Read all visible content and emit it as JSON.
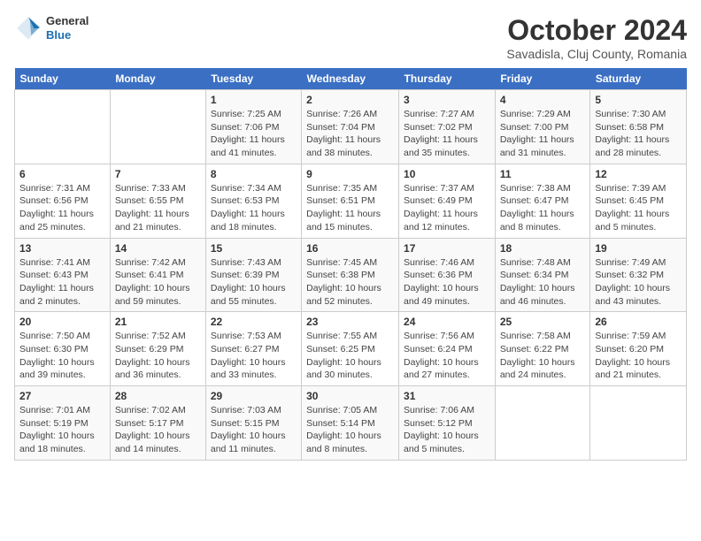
{
  "header": {
    "logo_line1": "General",
    "logo_line2": "Blue",
    "month": "October 2024",
    "location": "Savadisla, Cluj County, Romania"
  },
  "weekdays": [
    "Sunday",
    "Monday",
    "Tuesday",
    "Wednesday",
    "Thursday",
    "Friday",
    "Saturday"
  ],
  "weeks": [
    [
      {
        "day": "",
        "sunrise": "",
        "sunset": "",
        "daylight": ""
      },
      {
        "day": "",
        "sunrise": "",
        "sunset": "",
        "daylight": ""
      },
      {
        "day": "1",
        "sunrise": "Sunrise: 7:25 AM",
        "sunset": "Sunset: 7:06 PM",
        "daylight": "Daylight: 11 hours and 41 minutes."
      },
      {
        "day": "2",
        "sunrise": "Sunrise: 7:26 AM",
        "sunset": "Sunset: 7:04 PM",
        "daylight": "Daylight: 11 hours and 38 minutes."
      },
      {
        "day": "3",
        "sunrise": "Sunrise: 7:27 AM",
        "sunset": "Sunset: 7:02 PM",
        "daylight": "Daylight: 11 hours and 35 minutes."
      },
      {
        "day": "4",
        "sunrise": "Sunrise: 7:29 AM",
        "sunset": "Sunset: 7:00 PM",
        "daylight": "Daylight: 11 hours and 31 minutes."
      },
      {
        "day": "5",
        "sunrise": "Sunrise: 7:30 AM",
        "sunset": "Sunset: 6:58 PM",
        "daylight": "Daylight: 11 hours and 28 minutes."
      }
    ],
    [
      {
        "day": "6",
        "sunrise": "Sunrise: 7:31 AM",
        "sunset": "Sunset: 6:56 PM",
        "daylight": "Daylight: 11 hours and 25 minutes."
      },
      {
        "day": "7",
        "sunrise": "Sunrise: 7:33 AM",
        "sunset": "Sunset: 6:55 PM",
        "daylight": "Daylight: 11 hours and 21 minutes."
      },
      {
        "day": "8",
        "sunrise": "Sunrise: 7:34 AM",
        "sunset": "Sunset: 6:53 PM",
        "daylight": "Daylight: 11 hours and 18 minutes."
      },
      {
        "day": "9",
        "sunrise": "Sunrise: 7:35 AM",
        "sunset": "Sunset: 6:51 PM",
        "daylight": "Daylight: 11 hours and 15 minutes."
      },
      {
        "day": "10",
        "sunrise": "Sunrise: 7:37 AM",
        "sunset": "Sunset: 6:49 PM",
        "daylight": "Daylight: 11 hours and 12 minutes."
      },
      {
        "day": "11",
        "sunrise": "Sunrise: 7:38 AM",
        "sunset": "Sunset: 6:47 PM",
        "daylight": "Daylight: 11 hours and 8 minutes."
      },
      {
        "day": "12",
        "sunrise": "Sunrise: 7:39 AM",
        "sunset": "Sunset: 6:45 PM",
        "daylight": "Daylight: 11 hours and 5 minutes."
      }
    ],
    [
      {
        "day": "13",
        "sunrise": "Sunrise: 7:41 AM",
        "sunset": "Sunset: 6:43 PM",
        "daylight": "Daylight: 11 hours and 2 minutes."
      },
      {
        "day": "14",
        "sunrise": "Sunrise: 7:42 AM",
        "sunset": "Sunset: 6:41 PM",
        "daylight": "Daylight: 10 hours and 59 minutes."
      },
      {
        "day": "15",
        "sunrise": "Sunrise: 7:43 AM",
        "sunset": "Sunset: 6:39 PM",
        "daylight": "Daylight: 10 hours and 55 minutes."
      },
      {
        "day": "16",
        "sunrise": "Sunrise: 7:45 AM",
        "sunset": "Sunset: 6:38 PM",
        "daylight": "Daylight: 10 hours and 52 minutes."
      },
      {
        "day": "17",
        "sunrise": "Sunrise: 7:46 AM",
        "sunset": "Sunset: 6:36 PM",
        "daylight": "Daylight: 10 hours and 49 minutes."
      },
      {
        "day": "18",
        "sunrise": "Sunrise: 7:48 AM",
        "sunset": "Sunset: 6:34 PM",
        "daylight": "Daylight: 10 hours and 46 minutes."
      },
      {
        "day": "19",
        "sunrise": "Sunrise: 7:49 AM",
        "sunset": "Sunset: 6:32 PM",
        "daylight": "Daylight: 10 hours and 43 minutes."
      }
    ],
    [
      {
        "day": "20",
        "sunrise": "Sunrise: 7:50 AM",
        "sunset": "Sunset: 6:30 PM",
        "daylight": "Daylight: 10 hours and 39 minutes."
      },
      {
        "day": "21",
        "sunrise": "Sunrise: 7:52 AM",
        "sunset": "Sunset: 6:29 PM",
        "daylight": "Daylight: 10 hours and 36 minutes."
      },
      {
        "day": "22",
        "sunrise": "Sunrise: 7:53 AM",
        "sunset": "Sunset: 6:27 PM",
        "daylight": "Daylight: 10 hours and 33 minutes."
      },
      {
        "day": "23",
        "sunrise": "Sunrise: 7:55 AM",
        "sunset": "Sunset: 6:25 PM",
        "daylight": "Daylight: 10 hours and 30 minutes."
      },
      {
        "day": "24",
        "sunrise": "Sunrise: 7:56 AM",
        "sunset": "Sunset: 6:24 PM",
        "daylight": "Daylight: 10 hours and 27 minutes."
      },
      {
        "day": "25",
        "sunrise": "Sunrise: 7:58 AM",
        "sunset": "Sunset: 6:22 PM",
        "daylight": "Daylight: 10 hours and 24 minutes."
      },
      {
        "day": "26",
        "sunrise": "Sunrise: 7:59 AM",
        "sunset": "Sunset: 6:20 PM",
        "daylight": "Daylight: 10 hours and 21 minutes."
      }
    ],
    [
      {
        "day": "27",
        "sunrise": "Sunrise: 7:01 AM",
        "sunset": "Sunset: 5:19 PM",
        "daylight": "Daylight: 10 hours and 18 minutes."
      },
      {
        "day": "28",
        "sunrise": "Sunrise: 7:02 AM",
        "sunset": "Sunset: 5:17 PM",
        "daylight": "Daylight: 10 hours and 14 minutes."
      },
      {
        "day": "29",
        "sunrise": "Sunrise: 7:03 AM",
        "sunset": "Sunset: 5:15 PM",
        "daylight": "Daylight: 10 hours and 11 minutes."
      },
      {
        "day": "30",
        "sunrise": "Sunrise: 7:05 AM",
        "sunset": "Sunset: 5:14 PM",
        "daylight": "Daylight: 10 hours and 8 minutes."
      },
      {
        "day": "31",
        "sunrise": "Sunrise: 7:06 AM",
        "sunset": "Sunset: 5:12 PM",
        "daylight": "Daylight: 10 hours and 5 minutes."
      },
      {
        "day": "",
        "sunrise": "",
        "sunset": "",
        "daylight": ""
      },
      {
        "day": "",
        "sunrise": "",
        "sunset": "",
        "daylight": ""
      }
    ]
  ]
}
